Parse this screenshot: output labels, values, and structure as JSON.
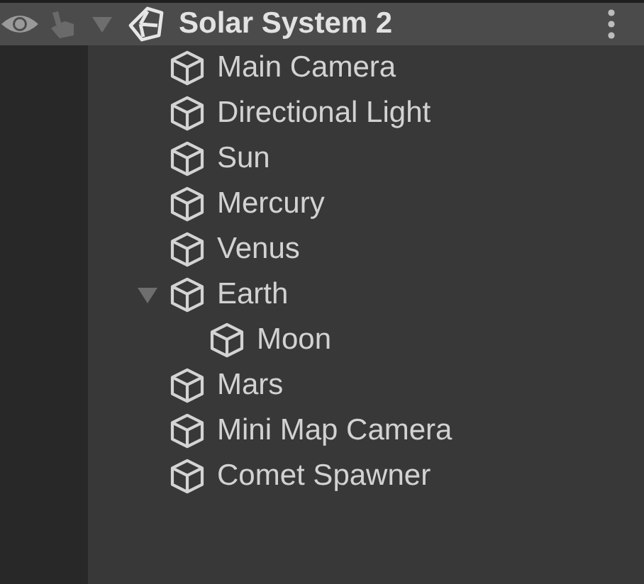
{
  "scene": {
    "title": "Solar System 2",
    "expanded": true
  },
  "items": [
    {
      "name": "Main Camera"
    },
    {
      "name": "Directional Light"
    },
    {
      "name": "Sun"
    },
    {
      "name": "Mercury"
    },
    {
      "name": "Venus"
    },
    {
      "name": "Earth",
      "expanded": true,
      "children": [
        {
          "name": "Moon"
        }
      ]
    },
    {
      "name": "Mars"
    },
    {
      "name": "Mini Map Camera"
    },
    {
      "name": "Comet Spawner"
    }
  ]
}
